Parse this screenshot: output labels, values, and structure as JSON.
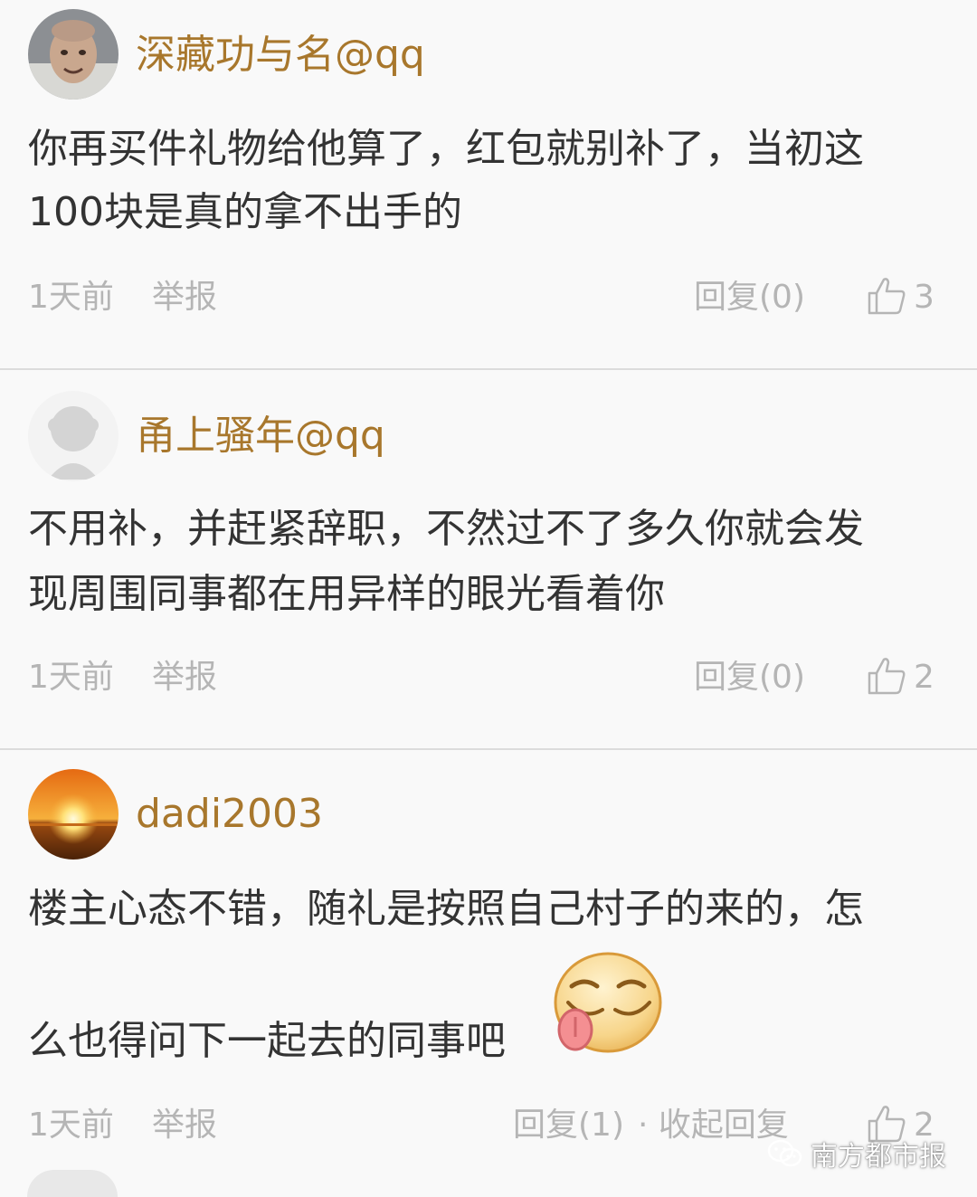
{
  "comments": [
    {
      "username": "深藏功与名@qq",
      "text_lines": [
        "你再买件礼物给他算了，红包就别补了，当初这",
        "100块是真的拿不出手的"
      ],
      "time": "1天前",
      "report": "举报",
      "reply": "回复(0)",
      "likes": "3"
    },
    {
      "username": "甬上骚年@qq",
      "text_lines": [
        "不用补，并赶紧辞职，不然过不了多久你就会发",
        "现周围同事都在用异样的眼光看着你"
      ],
      "time": "1天前",
      "report": "举报",
      "reply": "回复(0)",
      "likes": "2"
    },
    {
      "username": "dadi2003",
      "text_lines": [
        "楼主心态不错，随礼是按照自己村子的来的，怎",
        "么也得问下一起去的同事吧"
      ],
      "time": "1天前",
      "report": "举报",
      "reply": "回复(1)",
      "collapse": "· 收起回复",
      "likes": "2"
    }
  ],
  "watermark": {
    "text": "南方都市报",
    "icon": "wechat-icon"
  },
  "colors": {
    "username": "#a8772c",
    "text": "#333333",
    "meta": "#b5b5b5",
    "background": "#f9f9f9",
    "divider": "#dcdcdc"
  }
}
